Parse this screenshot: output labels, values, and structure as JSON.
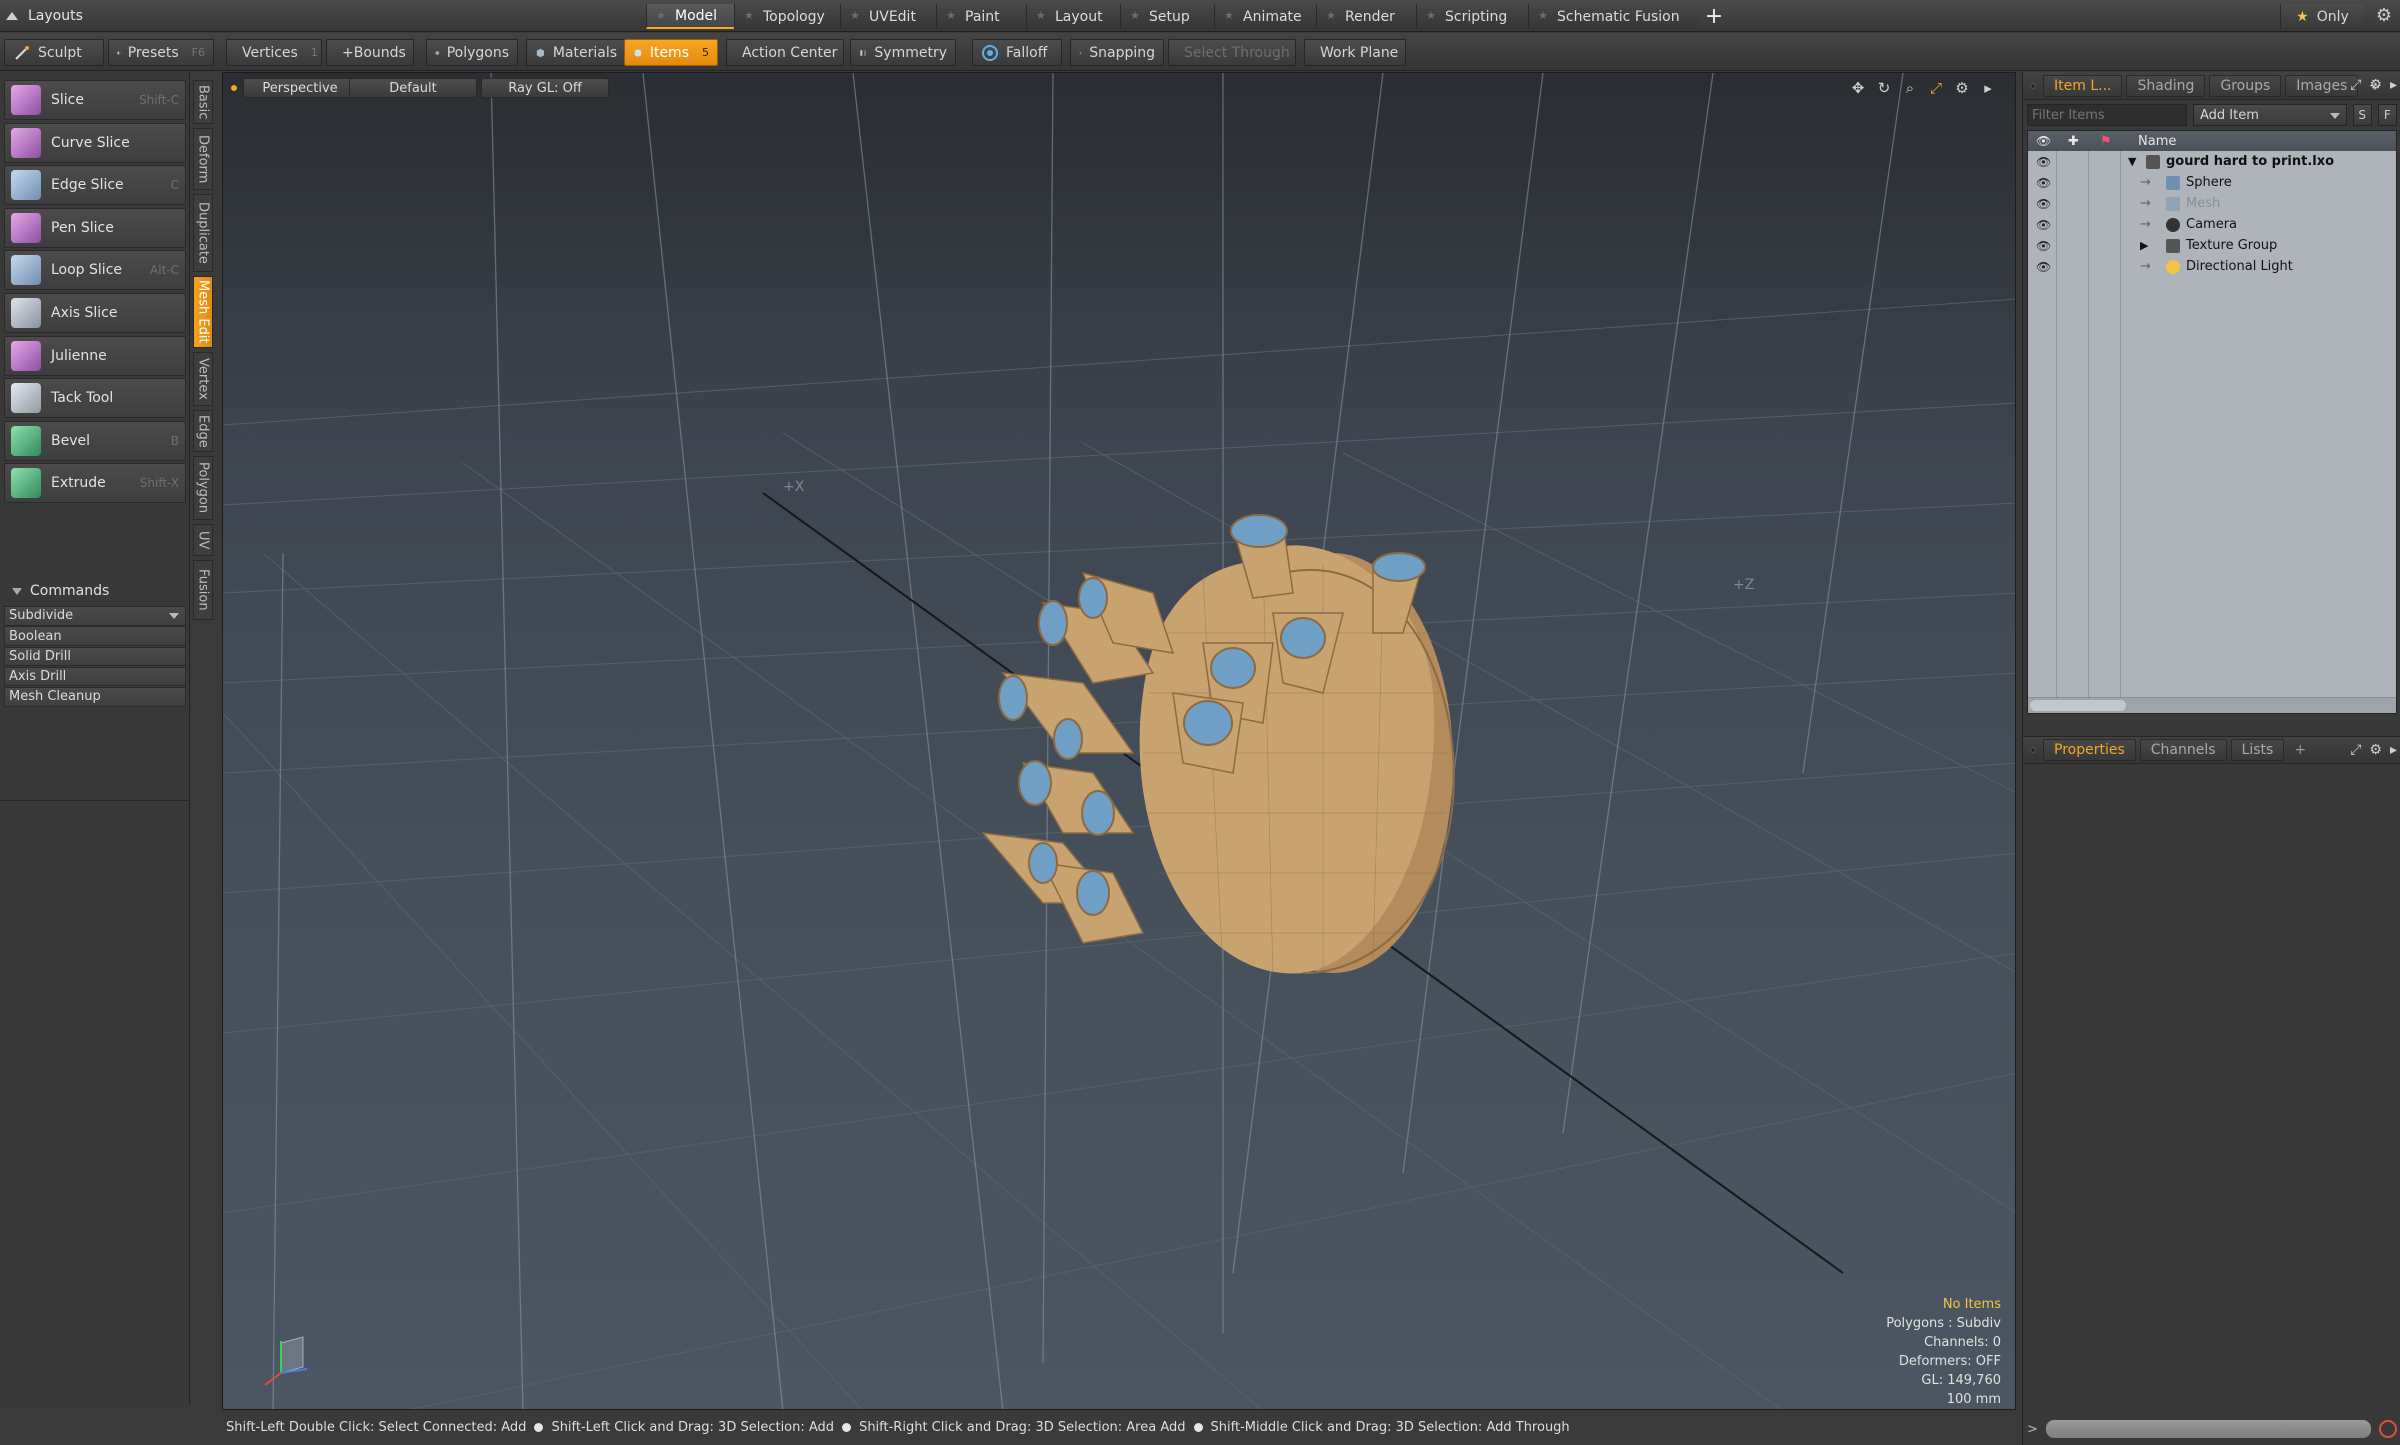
{
  "layout_bar": {
    "layouts_label": "Layouts",
    "tabs": [
      "Model",
      "Topology",
      "UVEdit",
      "Paint",
      "Layout",
      "Setup",
      "Animate",
      "Render",
      "Scripting",
      "Schematic Fusion"
    ],
    "active_tab": "Model",
    "add_label": "+",
    "only_label": "Only"
  },
  "toolbar": {
    "sculpt": "Sculpt",
    "presets": "Presets",
    "presets_key": "F6",
    "vertices": "Vertices",
    "vertices_key": "1",
    "bounds": "+Bounds",
    "polygons": "Polygons",
    "materials": "Materials",
    "items": "Items",
    "items_key": "5",
    "action_center": "Action Center",
    "symmetry": "Symmetry",
    "falloff": "Falloff",
    "snapping": "Snapping",
    "select_through": "Select Through",
    "work_plane": "Work Plane"
  },
  "tools": [
    {
      "name": "Slice",
      "key": "Shift-C"
    },
    {
      "name": "Curve Slice",
      "key": ""
    },
    {
      "name": "Edge Slice",
      "key": "C"
    },
    {
      "name": "Pen Slice",
      "key": ""
    },
    {
      "name": "Loop Slice",
      "key": "Alt-C"
    },
    {
      "name": "Axis Slice",
      "key": ""
    },
    {
      "name": "Julienne",
      "key": ""
    },
    {
      "name": "Tack Tool",
      "key": ""
    },
    {
      "name": "Bevel",
      "key": "B"
    },
    {
      "name": "Extrude",
      "key": "Shift-X"
    }
  ],
  "commands": {
    "header": "Commands",
    "items": [
      "Subdivide",
      "Boolean",
      "Solid Drill",
      "Axis Drill",
      "Mesh Cleanup"
    ]
  },
  "vertical_tabs": [
    "Basic",
    "Deform",
    "Duplicate",
    "Mesh Edit",
    "Vertex",
    "Edge",
    "Polygon",
    "UV",
    "Fusion"
  ],
  "viewport": {
    "view_mode": "Perspective",
    "shading": "Default",
    "raygl": "Ray GL: Off",
    "info": {
      "selection": "No Items",
      "polygons": "Polygons : Subdiv",
      "channels": "Channels: 0",
      "deformers": "Deformers: OFF",
      "gl": "GL: 149,760",
      "units": "100 mm"
    }
  },
  "status": {
    "hints": [
      "Shift-Left Double Click: Select Connected: Add",
      "Shift-Left Click and Drag: 3D Selection: Add",
      "Shift-Right Click and Drag: 3D Selection: Area Add",
      "Shift-Middle Click and Drag: 3D Selection: Add Through"
    ]
  },
  "item_list": {
    "tabs": [
      "Item L...",
      "Shading",
      "Groups",
      "Images"
    ],
    "filter_placeholder": "Filter Items",
    "add_item": "Add Item",
    "s_label": "S",
    "f_label": "F",
    "name_header": "Name",
    "items": [
      {
        "label": "gourd hard to print.lxo",
        "kind": "scene"
      },
      {
        "label": "Sphere",
        "kind": "mesh"
      },
      {
        "label": "Mesh",
        "kind": "mesh"
      },
      {
        "label": "Camera",
        "kind": "camera"
      },
      {
        "label": "Texture Group",
        "kind": "group"
      },
      {
        "label": "Directional Light",
        "kind": "light"
      }
    ]
  },
  "properties": {
    "tabs": [
      "Properties",
      "Channels",
      "Lists"
    ]
  },
  "command_line": {
    "prompt": ">"
  },
  "colors": {
    "accent": "#f5a623",
    "model": "#c9a36f",
    "inset": "#6f9fc4"
  }
}
